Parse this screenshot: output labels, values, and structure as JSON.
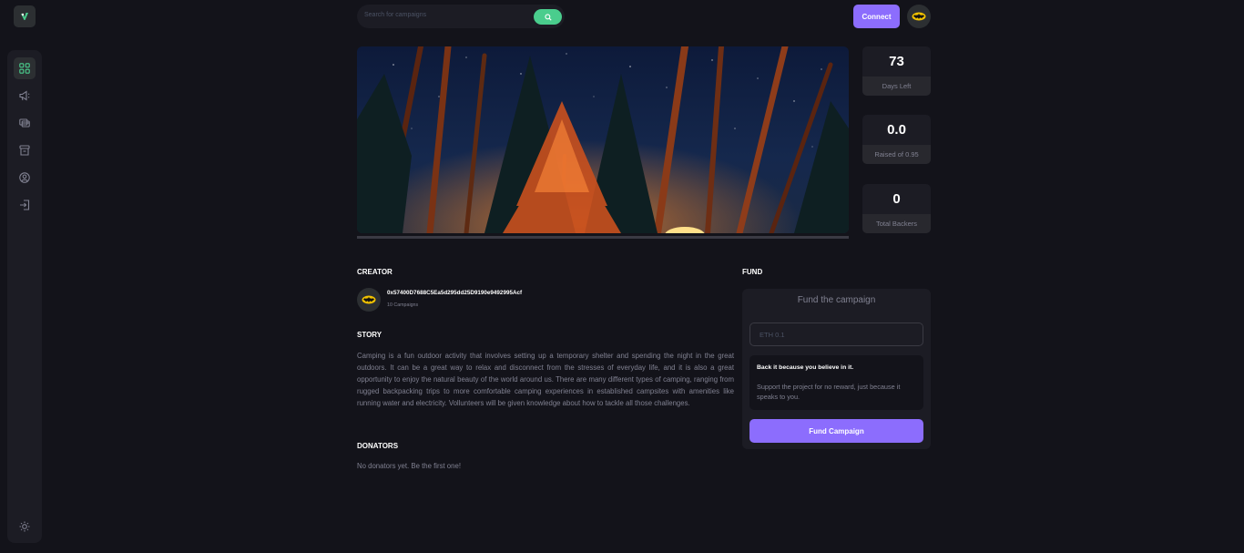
{
  "search": {
    "placeholder": "Search for campaigns"
  },
  "header": {
    "connect_label": "Connect"
  },
  "sidebar": {
    "items": [
      {
        "icon": "dashboard-icon",
        "active": true
      },
      {
        "icon": "campaign-icon",
        "active": false
      },
      {
        "icon": "payment-icon",
        "active": false
      },
      {
        "icon": "withdraw-icon",
        "active": false
      },
      {
        "icon": "profile-icon",
        "active": false
      },
      {
        "icon": "logout-icon",
        "active": false
      }
    ],
    "theme_icon": "sun-icon"
  },
  "stats": {
    "days_left": {
      "value": "73",
      "label": "Days Left"
    },
    "raised": {
      "value": "0.0",
      "label": "Raised of 0.95"
    },
    "backers": {
      "value": "0",
      "label": "Total Backers"
    }
  },
  "progress": {
    "fraction": 0.0
  },
  "creator": {
    "title": "CREATOR",
    "address": "0x57400D7688C5Ea5d295dd25D9190e9492995Acf",
    "campaigns": "10 Campaigns"
  },
  "story": {
    "title": "STORY",
    "text": "Camping is a fun outdoor activity that involves setting up a temporary shelter and spending the night in the great outdoors. It can be a great way to relax and disconnect from the stresses of everyday life, and it is also a great opportunity to enjoy the natural beauty of the world around us. There are many different types of camping, ranging from rugged backpacking trips to more comfortable camping experiences in established campsites with amenities like running water and electricity. Vollunteers will be given knowledge about how to tackle all those challenges."
  },
  "donators": {
    "title": "DONATORS",
    "empty_text": "No donators yet. Be the first one!"
  },
  "fund": {
    "title": "FUND",
    "heading": "Fund the campaign",
    "input_placeholder": "ETH 0.1",
    "note_title": "Back it because you believe in it.",
    "note_body": "Support the project for no reward, just because it speaks to you.",
    "button_label": "Fund Campaign"
  },
  "colors": {
    "accent_green": "#4acd8d",
    "accent_purple": "#8c6dfd",
    "background": "#13131a",
    "panel": "#1c1c24"
  }
}
